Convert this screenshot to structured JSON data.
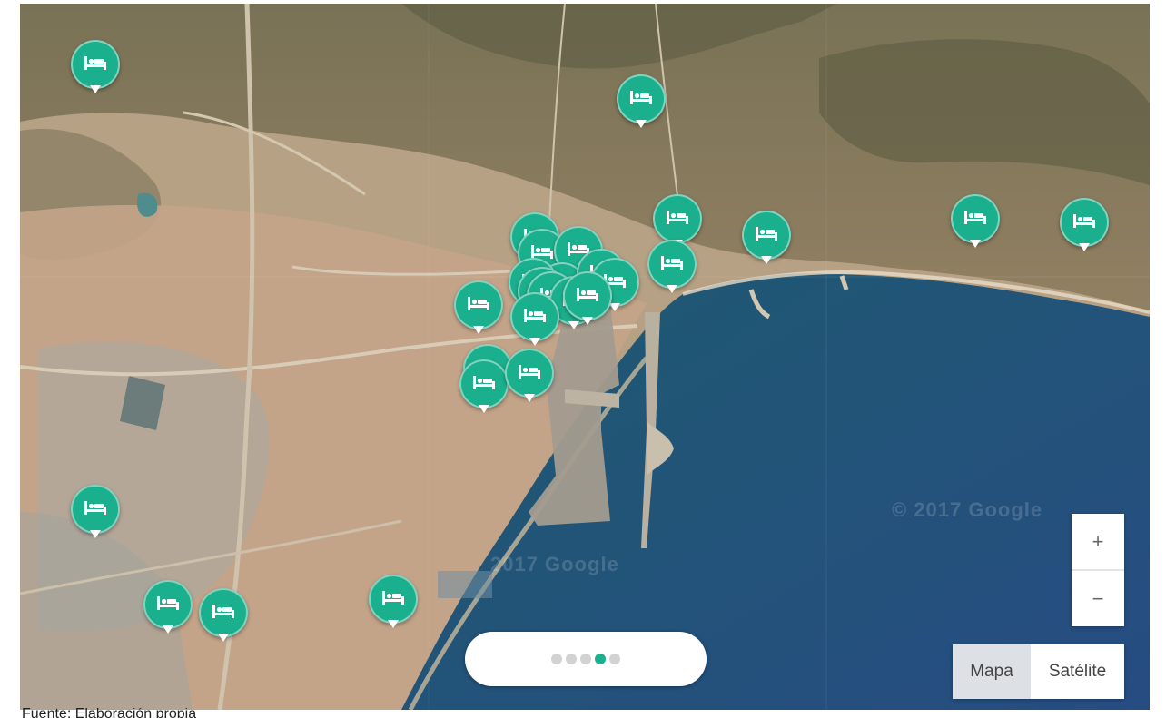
{
  "map": {
    "watermark_text": "© 2017 Google",
    "watermark_text_2": "2017 Google",
    "pin_icon": "hotel-bed-icon",
    "pin_color": "#1bb08d",
    "water_color": "#1f4d63",
    "land_color": "#b8a488",
    "hotel_markers_count": 26
  },
  "controls": {
    "zoom_in_label": "+",
    "zoom_out_label": "−",
    "map_type_options": [
      "Mapa",
      "Satélite"
    ],
    "map_type_selected": "Mapa"
  },
  "pager": {
    "total_dots": 5,
    "active_index": 3,
    "active_color": "#1bb08d"
  },
  "caption": "Fuente: Elaboración propia"
}
